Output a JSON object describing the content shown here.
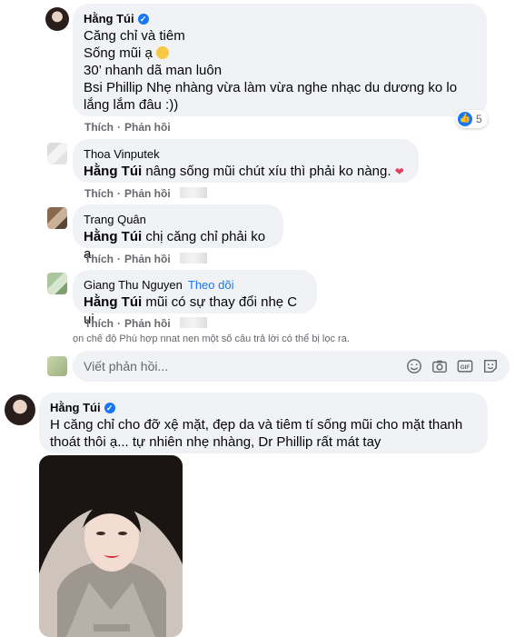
{
  "comment1": {
    "author": "Hằng Túi",
    "lines": [
      "Căng chỉ và tiêm",
      "Sống mũi ạ",
      "30’ nhanh dã man luôn",
      "Bsi Phillip Nhẹ nhàng vừa làm vừa nghe nhạc du dương ko lo",
      "lắng lắm đâu :))"
    ],
    "like_label": "Thích",
    "reply_label": "Phản hồi",
    "reaction_count": "5"
  },
  "replies": [
    {
      "author": "Thoa Vinputek",
      "mention": "Hằng Túi",
      "text": "nâng sống mũi chút xíu thì phải ko nàng.",
      "like_label": "Thích",
      "reply_label": "Phản hồi"
    },
    {
      "author": "Trang Quân",
      "mention": "Hằng Túi",
      "text": "chị căng chỉ phải ko ạ",
      "like_label": "Thích",
      "reply_label": "Phản hồi"
    },
    {
      "author": "Giang Thu Nguyen",
      "follow": "Theo dõi",
      "mention": "Hằng Túi",
      "text": "mũi có sự thay đổi nhẹ C ui",
      "like_label": "Thích",
      "reply_label": "Phản hồi"
    }
  ],
  "filter_notice": "ọn chế độ Phù hợp nnat nen một số câu trả lời có thể bị lọc ra.",
  "reply_box": {
    "placeholder": "Viết phản hồi...",
    "icons": [
      "smiley-icon",
      "camera-icon",
      "gif-icon",
      "sticker-icon"
    ]
  },
  "comment2": {
    "author": "Hằng Túi",
    "lines": [
      "H căng chỉ cho đỡ xệ mặt, đẹp da và tiêm tí sống mũi cho mặt thanh",
      "thoát thôi ạ... tự nhiên nhẹ nhàng, Dr Phillip rất mát tay"
    ]
  },
  "colors": {
    "bubble": "#f0f2f5",
    "link": "#1877f2",
    "muted": "#65676b",
    "text": "#050505"
  }
}
